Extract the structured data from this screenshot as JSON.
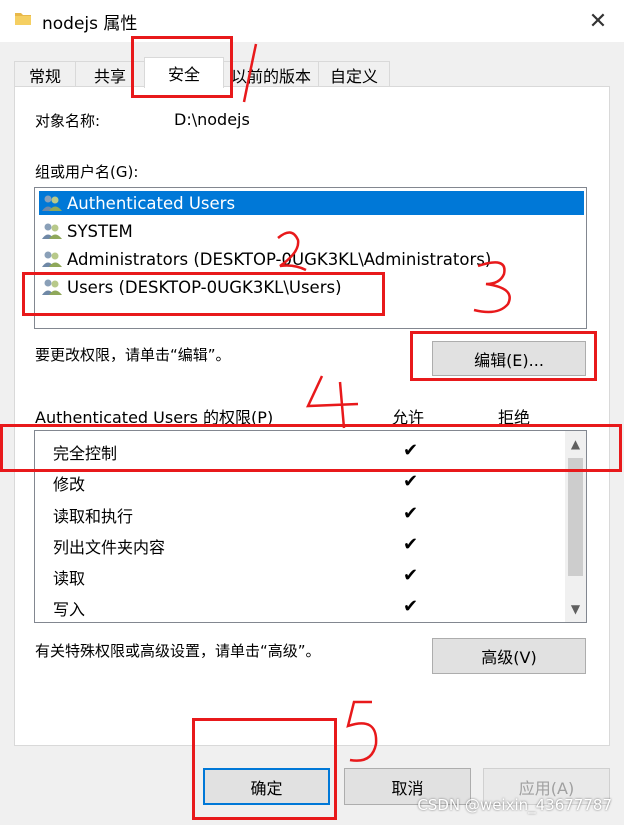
{
  "window": {
    "title": "nodejs 属性",
    "close_glyph": "✕"
  },
  "tabs": [
    {
      "label": "常规",
      "active": false
    },
    {
      "label": "共享",
      "active": false
    },
    {
      "label": "安全",
      "active": true
    },
    {
      "label": "以前的版本",
      "active": false
    },
    {
      "label": "自定义",
      "active": false
    }
  ],
  "security": {
    "object_name_label": "对象名称:",
    "object_name_value": "D:\\nodejs",
    "group_label": "组或用户名(G):",
    "users": [
      {
        "name": "Authenticated Users",
        "selected": true
      },
      {
        "name": "SYSTEM",
        "selected": false
      },
      {
        "name": "Administrators (DESKTOP-0UGK3KL\\Administrators)",
        "selected": false
      },
      {
        "name": "Users (DESKTOP-0UGK3KL\\Users)",
        "selected": false
      }
    ],
    "change_hint": "要更改权限，请单击“编辑”。",
    "edit_button": "编辑(E)...",
    "perm_header": "Authenticated Users 的权限(P)",
    "allow_header": "允许",
    "deny_header": "拒绝",
    "permissions": [
      {
        "name": "完全控制",
        "allow": "✔"
      },
      {
        "name": "修改",
        "allow": "✔"
      },
      {
        "name": "读取和执行",
        "allow": "✔"
      },
      {
        "name": "列出文件夹内容",
        "allow": "✔"
      },
      {
        "name": "读取",
        "allow": "✔"
      },
      {
        "name": "写入",
        "allow": "✔"
      }
    ],
    "advanced_hint": "有关特殊权限或高级设置，请单击“高级”。",
    "advanced_button": "高级(V)"
  },
  "footer": {
    "ok": "确定",
    "cancel": "取消",
    "apply": "应用(A)"
  },
  "watermark": "CSDN @weixin_43677787",
  "annotations": {
    "color": "#e8191b",
    "numbers": [
      "1",
      "2",
      "3",
      "4",
      "5"
    ]
  }
}
